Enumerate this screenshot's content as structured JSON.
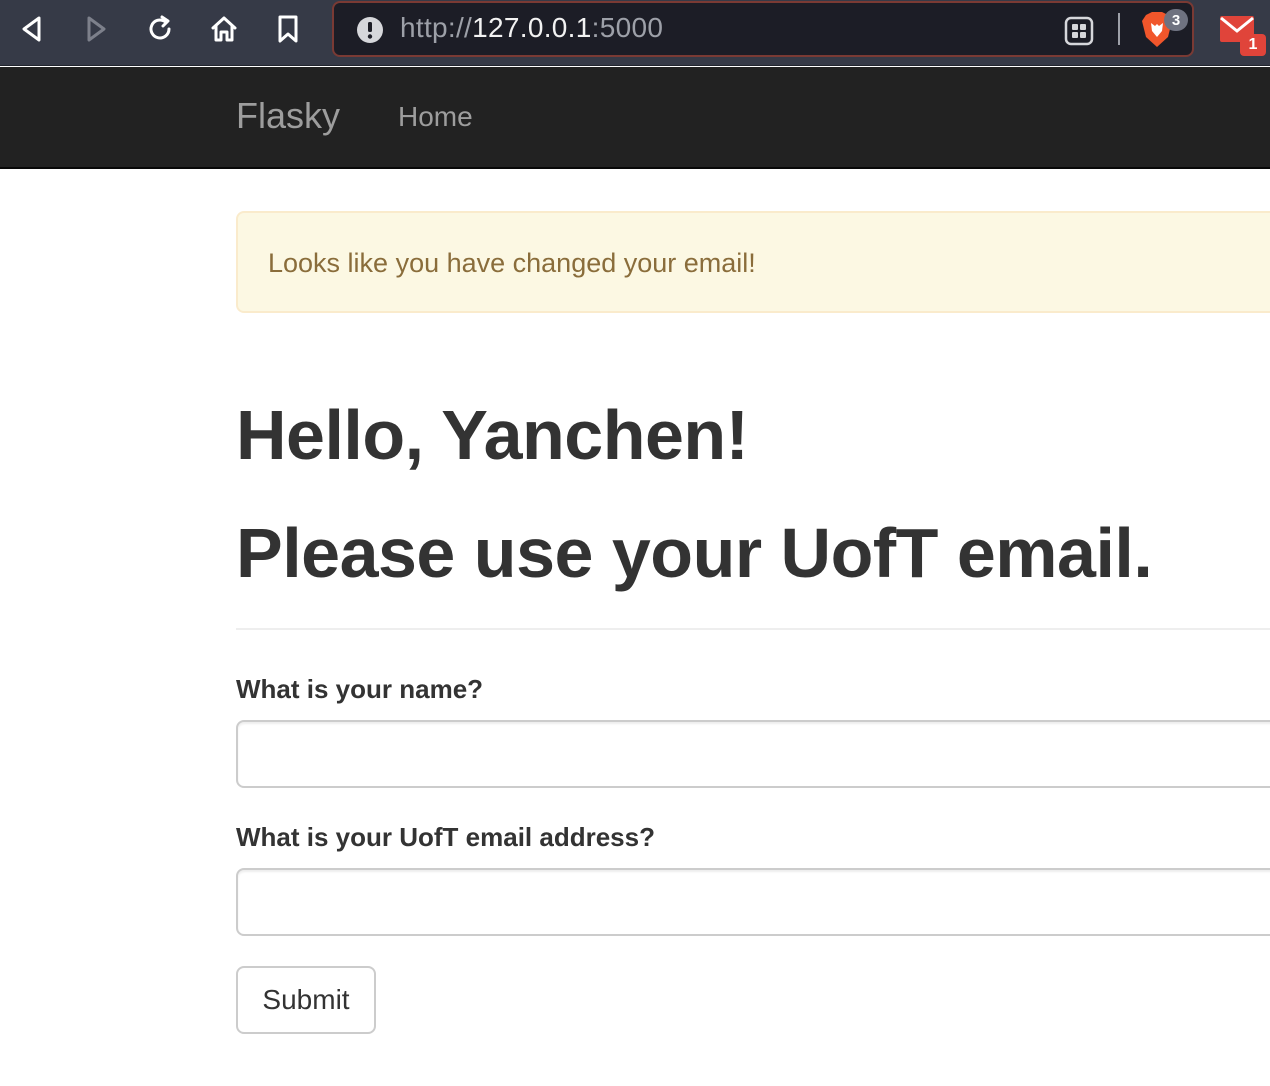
{
  "browser": {
    "url_scheme": "http://",
    "url_host": "127.0.0.1",
    "url_port": ":5000",
    "brave_badge_count": "3",
    "mail_badge_count": "1",
    "icons": [
      "back-icon",
      "forward-icon",
      "reload-icon",
      "home-icon",
      "bookmark-icon",
      "info-icon",
      "qr-code-icon",
      "brave-shield-icon",
      "mail-icon"
    ],
    "colors": {
      "chrome_bg": "#363a47",
      "urlbar_bg": "#1c1d26",
      "urlbar_border": "#7a3a34",
      "brave_orange": "#f1562b",
      "mail_red": "#e0443a"
    }
  },
  "navbar": {
    "brand": "Flasky",
    "links": [
      {
        "label": "Home"
      }
    ]
  },
  "alert": {
    "message": "Looks like you have changed your email!"
  },
  "page_header": {
    "line1": "Hello, Yanchen!",
    "line2": "Please use your UofT email."
  },
  "form": {
    "name_label": "What is your name?",
    "name_value": "",
    "email_label": "What is your UofT email address?",
    "email_value": "",
    "submit_label": "Submit"
  }
}
